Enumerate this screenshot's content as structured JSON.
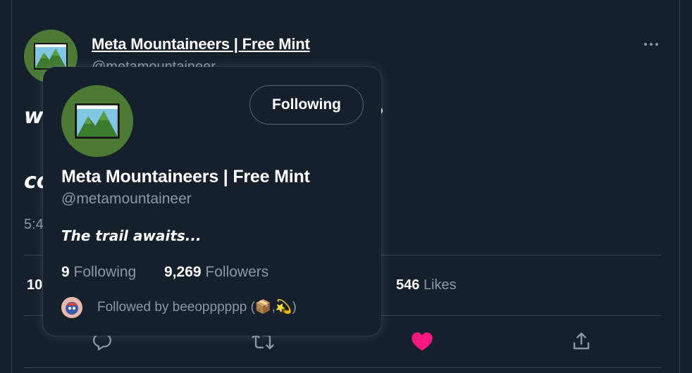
{
  "tweet": {
    "author_name": "Meta Mountaineers | Free Mint",
    "author_handle": "@metamountaineer",
    "text_line_1": "w",
    "text_line_1_end": "d?",
    "text_line_2": "co",
    "time_partial": "5:4",
    "retweets_partial": "10",
    "likes_count": "546",
    "likes_label": "Likes",
    "liked": true,
    "like_color": "#f91880"
  },
  "hovercard": {
    "name": "Meta Mountaineers | Free Mint",
    "handle": "@metamountaineer",
    "follow_button_label": "Following",
    "bio": "The trail awaits...",
    "following_count": "9",
    "following_label": "Following",
    "followers_count": "9,269",
    "followers_label": "Followers",
    "followed_by_text": "Followed by beeopppppp (📦,💫)"
  },
  "icons": {
    "more": "more-horizontal-icon",
    "reply": "reply-icon",
    "retweet": "retweet-icon",
    "like": "heart-icon",
    "share": "share-icon"
  },
  "colors": {
    "background": "#15202b",
    "border": "#38444d",
    "secondary_text": "#8b98a5",
    "avatar_green": "#4c7a35"
  }
}
